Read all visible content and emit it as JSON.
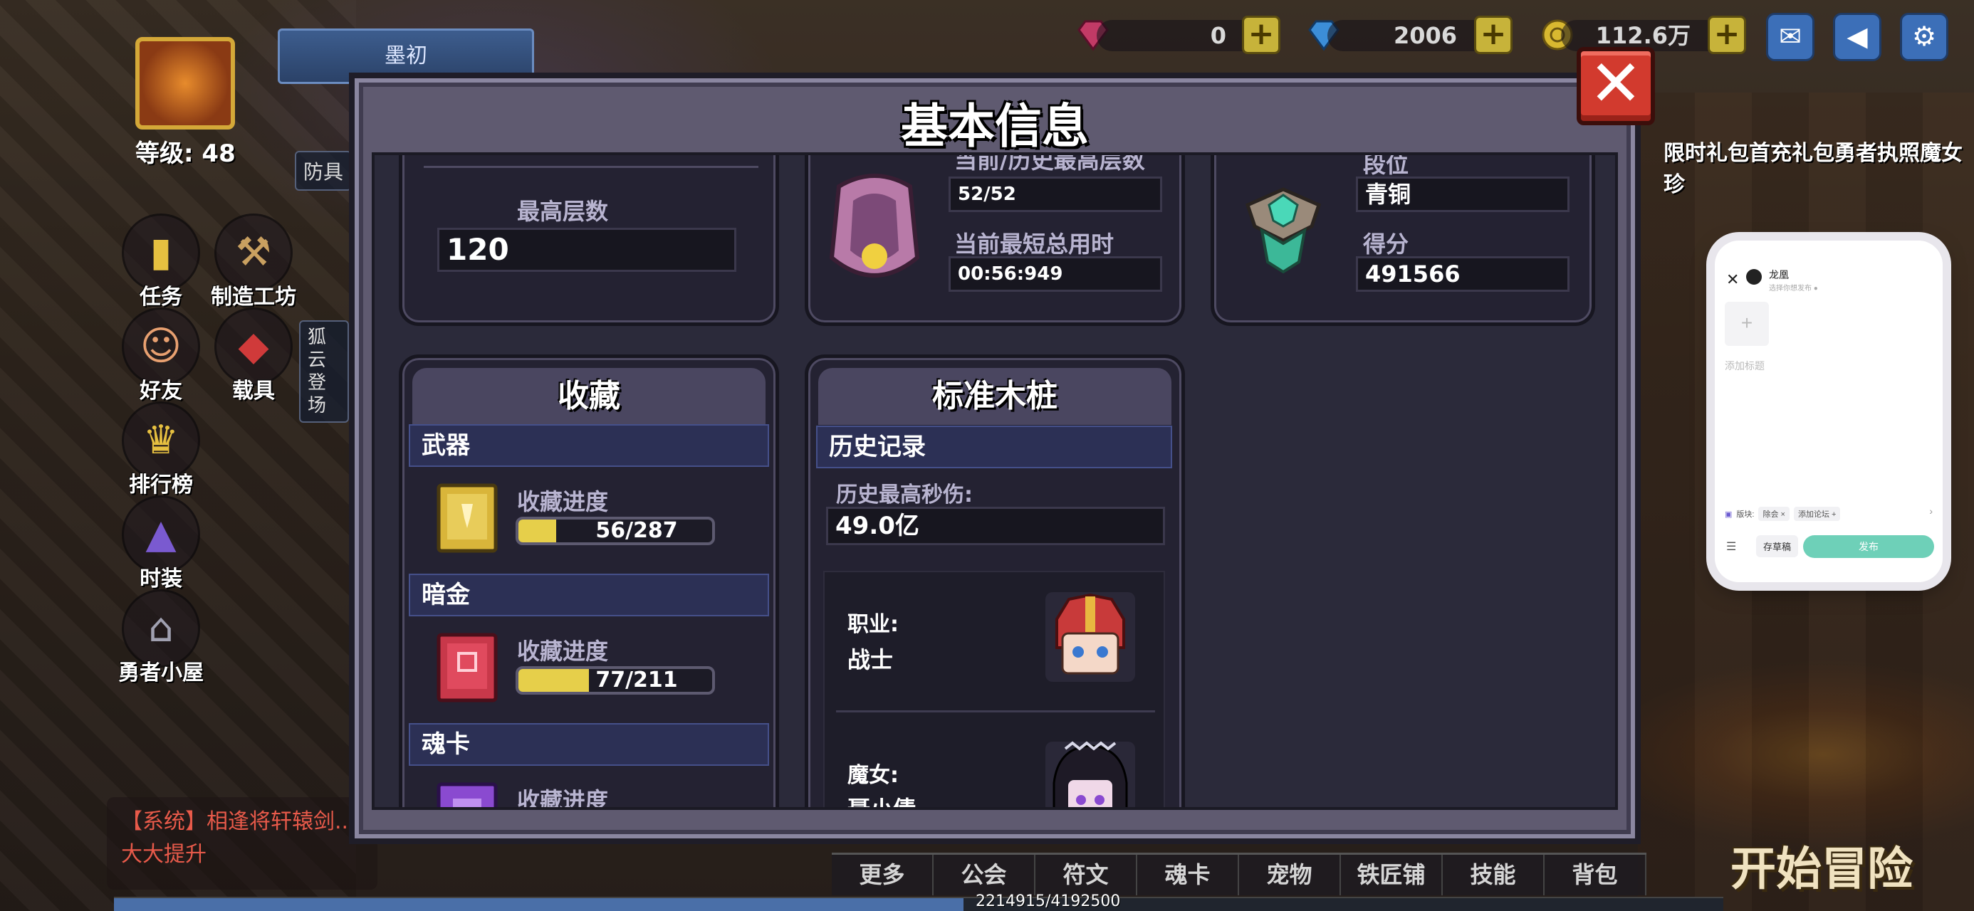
{
  "player": {
    "name": "墨初",
    "level": "等级: 48"
  },
  "resources": {
    "gems": "0",
    "diamonds": "2006",
    "gold": "112.6万"
  },
  "top_banners": [
    "限时礼包",
    "首充礼包",
    "勇者执照",
    "魔女珍"
  ],
  "side_chips": {
    "armor": "防具",
    "event": "狐云登场"
  },
  "left_menu": [
    {
      "label": "任务",
      "icon": "task-icon"
    },
    {
      "label": "制造工坊",
      "icon": "workshop-icon"
    },
    {
      "label": "好友",
      "icon": "friends-icon"
    },
    {
      "label": "载具",
      "icon": "vehicle-icon"
    },
    {
      "label": "排行榜",
      "icon": "trophy-icon"
    },
    {
      "label": "时装",
      "icon": "costume-icon"
    },
    {
      "label": "勇者小屋",
      "icon": "house-icon"
    }
  ],
  "system_message": {
    "line1": "【系统】相逢将轩辕剑...",
    "line2": "大大提升"
  },
  "bottom_tabs": [
    "更多",
    "公会",
    "符文",
    "魂卡",
    "宠物",
    "铁匠铺",
    "技能",
    "背包"
  ],
  "exp": {
    "text": "2214915/4192500",
    "fraction": 0.528
  },
  "start_button": "开始冒险",
  "dialog": {
    "title": "基本信息",
    "close": "✕",
    "tower": {
      "max_floor_label": "最高层数",
      "max_floor_value": "120"
    },
    "dungeon": {
      "history_label": "当前/历史最高层数",
      "history_value": "52/52",
      "time_label": "当前最短总用时",
      "time_value": "00:56:949"
    },
    "rank": {
      "tier_label": "段位",
      "tier_value": "青铜",
      "score_label": "得分",
      "score_value": "491566"
    },
    "collection": {
      "title": "收藏",
      "progress_label": "收藏进度",
      "items": [
        {
          "category": "武器",
          "progress": "56/287",
          "fraction": 0.195,
          "icon": "weapon-card-icon",
          "color": "#d9b53a"
        },
        {
          "category": "暗金",
          "progress": "77/211",
          "fraction": 0.365,
          "icon": "darkgold-card-icon",
          "color": "#c8384a"
        },
        {
          "category": "魂卡",
          "progress": "",
          "fraction": 0,
          "icon": "soulcard-icon",
          "color": "#8a4ad0"
        }
      ]
    },
    "dummy": {
      "title": "标准木桩",
      "record_header": "历史记录",
      "max_dps_label": "历史最高秒伤:",
      "max_dps_value": "49.0亿",
      "class_label": "职业:",
      "class_value": "战士",
      "witch_label": "魔女:",
      "witch_value": "聂小倩"
    }
  },
  "post_panel": {
    "user": "龙凰",
    "sub": "选择你想发布 ●",
    "title_placeholder": "添加标题",
    "tag_prefix": "版块:",
    "tag1": "除会 ×",
    "tag2": "添加论坛 +",
    "draft": "存草稿",
    "publish": "发布"
  }
}
